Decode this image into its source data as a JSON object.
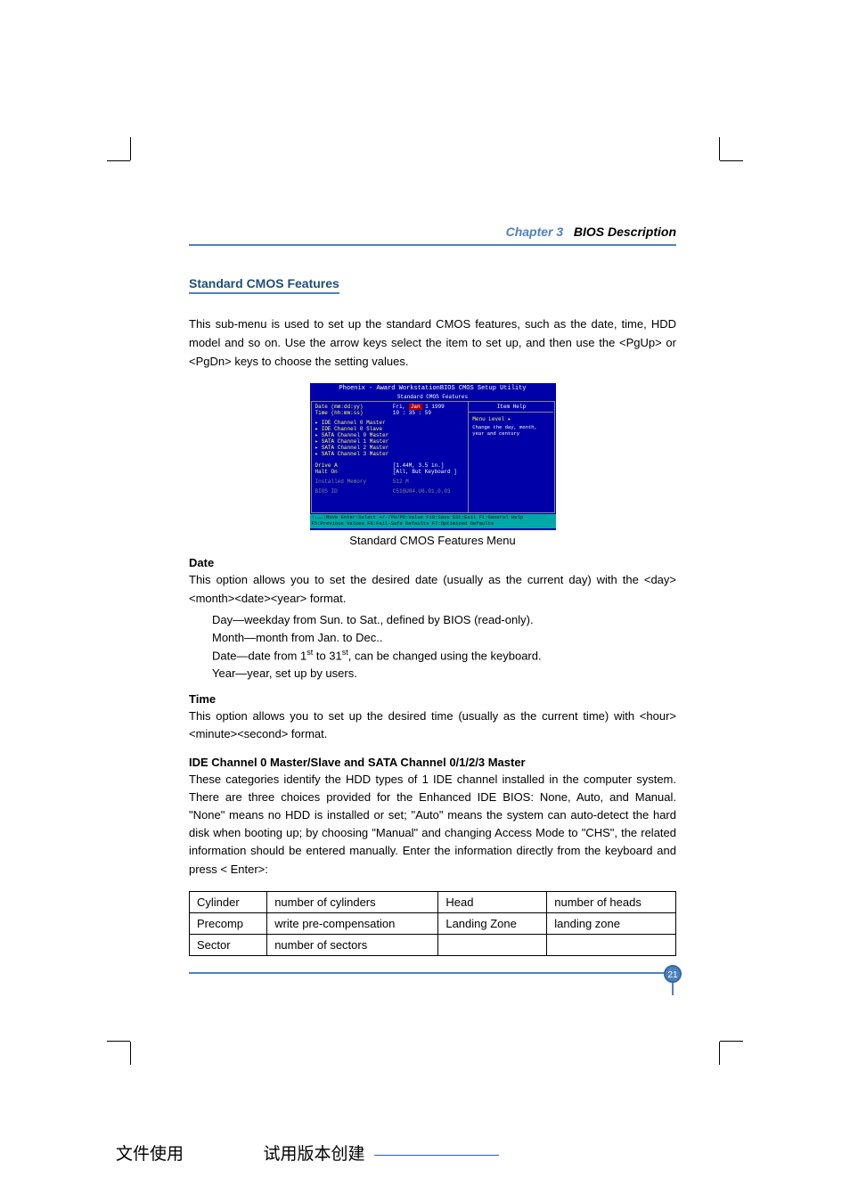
{
  "chapter": {
    "label": "Chapter 3",
    "title": "BIOS Description"
  },
  "section_title": "Standard CMOS Features",
  "intro": "This sub-menu is used to set up the standard CMOS features, such as the date, time, HDD model and so on. Use the arrow keys select the item to set up, and then use the <PgUp> or <PgDn> keys to choose the setting values.",
  "bios": {
    "top": "Phoenix - Award WorkstationBIOS CMOS Setup Utility",
    "sub": "Standard CMOS Features",
    "date_label": "Date (mm:dd:yy)",
    "date_val_prefix": "Fri, ",
    "date_val_highlight": "Jan",
    "date_val_suffix": "  1 1999",
    "time_label": "Time (hh:mm:ss)",
    "time_val": "10 : 35 : 59",
    "items": [
      "IDE Channel 0 Master",
      "IDE Channel 0 Slave",
      "SATA Channel 0 Master",
      "SATA Channel 1 Master",
      "SATA Channel 2 Master",
      "SATA Channel 3 Master"
    ],
    "driveA_label": "Drive A",
    "driveA_val": "[1.44M, 3.5 in.]",
    "halt_label": "Halt On",
    "halt_val": "[All, But Keyboard ]",
    "mem_label": "Installed Memory",
    "mem_val": "512 M",
    "biosid_label": "BIOS ID",
    "biosid_val": "C51GU04.U6.01.0.03",
    "right_hdr": "Item Help",
    "menu_level": "Menu Level   ▸",
    "help_text": "Change the day, month, year and century",
    "footer1": "↑↓→←:Move  Enter:Select  +/-/PU/PD:Value  F10:Save  ESC:Exit  F1:General Help",
    "footer2": "F5:Previous Values    F6:Fail-Safe Defaults    F7:Optimized Defaults"
  },
  "caption": "Standard CMOS Features Menu",
  "date": {
    "head": "Date",
    "text": "This option allows you to set the desired date (usually as the current day) with the <day><month><date><year> format.",
    "l1": "Day—weekday from Sun. to Sat., defined by BIOS (read-only).",
    "l2": "Month—month from Jan. to Dec..",
    "l3a": "Date—date from 1",
    "l3b": " to 31",
    "l3c": ", can  be changed using the keyboard.",
    "l4": "Year—year, set up by users.",
    "sup": "st"
  },
  "time": {
    "head": "Time",
    "text": "This option allows you to set up the desired time (usually as the current time) with <hour><minute><second> format."
  },
  "ide": {
    "head": "IDE Channel 0 Master/Slave and SATA Channel 0/1/2/3 Master",
    "text": "These categories identify the HDD types of 1 IDE channel installed in the computer system. There are three choices provided for the Enhanced IDE BIOS: None, Auto, and Manual. \"None\" means no HDD is installed or set; \"Auto\" means the system can auto-detect the hard disk when booting up; by choosing \"Manual\" and changing Access Mode to \"CHS\", the related information should be entered manually. Enter the information directly from the keyboard and press < Enter>:"
  },
  "table": {
    "r1c1": "Cylinder",
    "r1c2": "number of cylinders",
    "r1c3": "Head",
    "r1c4": "number of heads",
    "r2c1": "Precomp",
    "r2c2": "write pre-compensation",
    "r2c3": "Landing Zone",
    "r2c4": "landing zone",
    "r3c1": "Sector",
    "r3c2": "number of sectors",
    "r3c3": "",
    "r3c4": ""
  },
  "page_number": "21",
  "watermark": {
    "left": "文件使用",
    "right": "试用版本创建"
  }
}
